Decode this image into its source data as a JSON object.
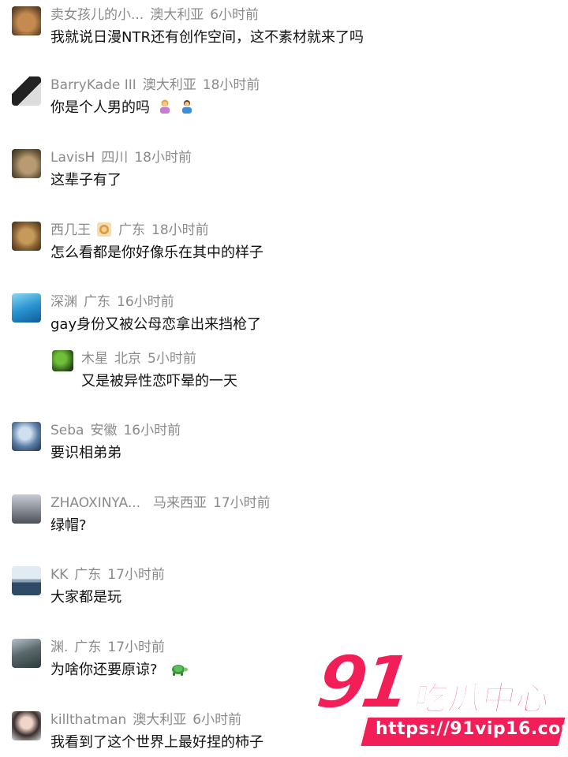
{
  "comments": [
    {
      "user": "卖女孩儿的小...",
      "location": "澳大利亚",
      "time": "6小时前",
      "text": "我就说日漫NTR还有创作空间，这不素材就来了吗"
    },
    {
      "user": "BarryKade III",
      "location": "澳大利亚",
      "time": "18小时前",
      "text": "你是个人男的吗"
    },
    {
      "user": "LavisH",
      "location": "四川",
      "time": "18小时前",
      "text": "这辈子有了"
    },
    {
      "user": "西几王",
      "location": "广东",
      "time": "18小时前",
      "text": "怎么看都是你好像乐在其中的样子"
    },
    {
      "user": "深渊",
      "location": "广东",
      "time": "16小时前",
      "text": "gay身份又被公母恋拿出来挡枪了"
    },
    {
      "user": "木星",
      "location": "北京",
      "time": "5小时前",
      "text": "又是被异性恋吓晕的一天"
    },
    {
      "user": "Seba",
      "location": "安徽",
      "time": "16小时前",
      "text": "要识相弟弟"
    },
    {
      "user": "ZHAOXINYA...",
      "location": "马来西亚",
      "time": "17小时前",
      "text": "绿帽?"
    },
    {
      "user": "KK",
      "location": "广东",
      "time": "17小时前",
      "text": "大家都是玩"
    },
    {
      "user": "渊.",
      "location": "广东",
      "time": "17小时前",
      "text": "为啥你还要原谅?"
    },
    {
      "user": "killthatman",
      "location": "澳大利亚",
      "time": "6小时前",
      "text": "我看到了这个世界上最好捏的柿子"
    }
  ],
  "icons": {
    "comment_2_emojis": [
      "person-gesturing-icon",
      "person-shrugging-icon"
    ],
    "comment_4_badge": "lion-badge-icon",
    "comment_10_emoji": "turtle-icon"
  },
  "watermark": {
    "number": "91",
    "brand": "吃瓜中心",
    "url": "https://91vip16.com"
  },
  "colors": {
    "watermark": "#f21e57",
    "meta_text": "#8a8a8a",
    "body_text": "#111111"
  }
}
